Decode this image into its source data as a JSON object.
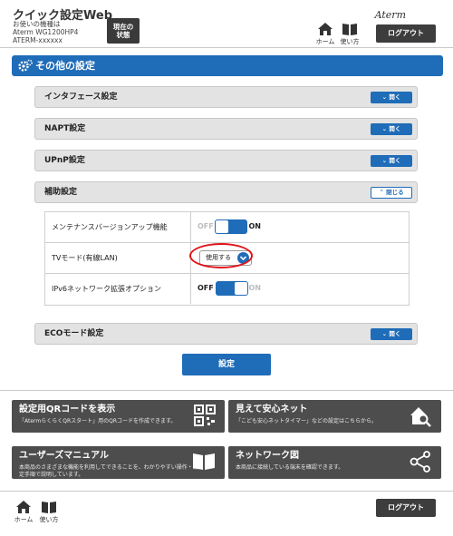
{
  "header": {
    "app_title": "クイック設定Web",
    "device_label": "お使いの機種は",
    "device_model": "Aterm WG1200HP4",
    "device_id": "ATERM-xxxxxx",
    "status_button": [
      "現在の",
      "状態"
    ],
    "nav": {
      "home_label": "ホーム",
      "manual_label": "使い方"
    },
    "brand": "Aterm",
    "logout_label": "ログアウト"
  },
  "page_title": "その他の設定",
  "sections": [
    {
      "label": "インタフェース設定",
      "button": "開く"
    },
    {
      "label": "NAPT設定",
      "button": "開く"
    },
    {
      "label": "UPnP設定",
      "button": "開く"
    },
    {
      "label": "補助設定",
      "button": "閉じる"
    },
    {
      "label": "ECOモード設定",
      "button": "開く"
    }
  ],
  "settings_rows": [
    {
      "label": "メンテナンスバージョンアップ機能",
      "off": "OFF",
      "on": "ON",
      "state": "on"
    },
    {
      "label": "TVモード(有線LAN)",
      "select_value": "使用する"
    },
    {
      "label": "IPv6ネットワーク拡張オプション",
      "off": "OFF",
      "on": "ON",
      "state": "off"
    }
  ],
  "apply_label": "設定",
  "cards": [
    {
      "title": "設定用QRコードを表示",
      "desc": "「AtermらくらくQRスタート」用のQRコードを作成できます。",
      "icon": "qr-code-icon"
    },
    {
      "title": "見えて安心ネット",
      "desc": "「こども安心ネットタイマー」などの設定はこちらから。",
      "icon": "house-search-icon"
    },
    {
      "title": "ユーザーズマニュアル",
      "desc": "本商品のさまざまな機能を利用してできることを、わかりやすい操作・設定手順で説明しています。",
      "icon": "book-icon"
    },
    {
      "title": "ネットワーク図",
      "desc": "本商品に接続している端末を確認できます。",
      "icon": "network-icon"
    }
  ],
  "footer": {
    "home_label": "ホーム",
    "manual_label": "使い方",
    "logout_label": "ログアウト"
  },
  "colors": {
    "primary": "#1f6cb8",
    "dark": "#3d3d3d",
    "card": "#4d4d4d",
    "highlight": "#e0141a"
  }
}
